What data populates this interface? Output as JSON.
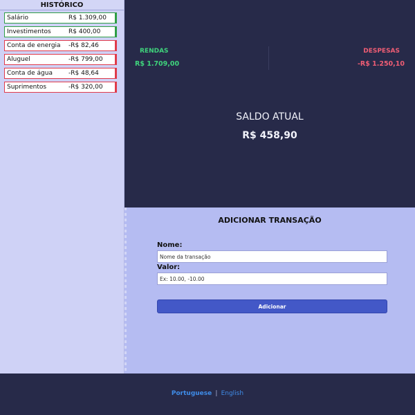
{
  "sidebar": {
    "title": "HISTÓRICO",
    "items": [
      {
        "name": "Salário",
        "value": "R$ 1.309,00",
        "type": "income"
      },
      {
        "name": "Investimentos",
        "value": "R$ 400,00",
        "type": "income"
      },
      {
        "name": "Conta de energia",
        "value": "-R$ 82,46",
        "type": "expense"
      },
      {
        "name": "Aluguel",
        "value": "-R$ 799,00",
        "type": "expense"
      },
      {
        "name": "Conta de água",
        "value": "-R$ 48,64",
        "type": "expense"
      },
      {
        "name": "Suprimentos",
        "value": "-R$ 320,00",
        "type": "expense"
      }
    ]
  },
  "summary": {
    "income_label": "RENDAS",
    "income_value": "R$ 1.709,00",
    "expense_label": "DESPESAS",
    "expense_value": "-R$ 1.250,10",
    "balance_label": "SALDO ATUAL",
    "balance_value": "R$ 458,90"
  },
  "form": {
    "title": "ADICIONAR TRANSAÇÃO",
    "name_label": "Nome:",
    "name_placeholder": "Nome da transação",
    "value_label": "Valor:",
    "value_placeholder": "Ex: 10.00, -10.00",
    "submit_label": "Adicionar"
  },
  "footer": {
    "lang_pt": "Portuguese",
    "separator": "|",
    "lang_en": "English"
  },
  "colors": {
    "income": "#2e9e45",
    "expense": "#e03a4a",
    "dark_panel": "#272a49",
    "accent_button": "#4358c7"
  }
}
